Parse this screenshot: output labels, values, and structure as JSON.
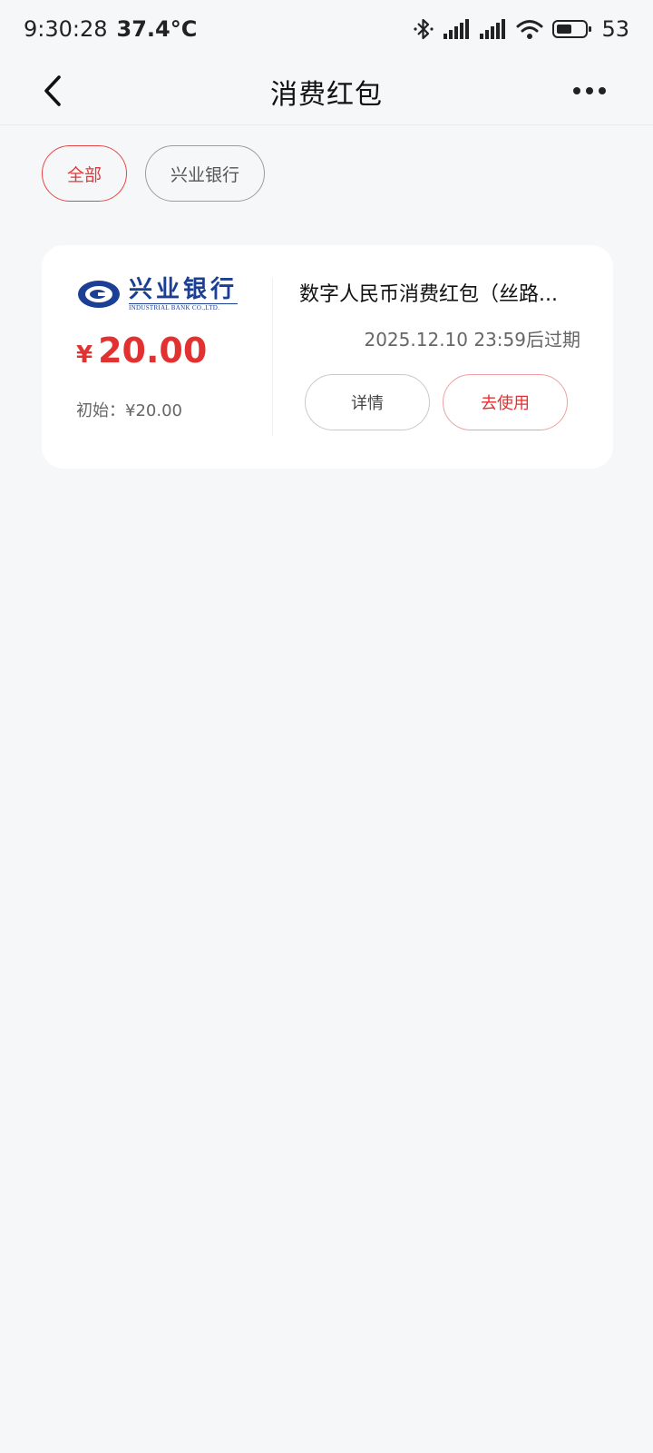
{
  "status_bar": {
    "time": "9:30:28",
    "temperature": "37.4°C",
    "battery": "53",
    "icons": [
      "bluetooth-icon",
      "signal-icon",
      "signal-icon",
      "wifi-icon",
      "battery-icon"
    ]
  },
  "header": {
    "title": "消费红包",
    "back_icon": "chevron-left-icon",
    "more_icon": "more-dots-icon"
  },
  "filters": [
    {
      "label": "全部",
      "active": true
    },
    {
      "label": "兴业银行",
      "active": false
    }
  ],
  "card": {
    "bank_logo": {
      "name_cn": "兴业银行",
      "name_en": "INDUSTRIAL BANK CO.,LTD."
    },
    "currency": "¥",
    "amount": "20.00",
    "initial": "初始：¥20.00",
    "title": "数字人民币消费红包（丝路...",
    "expire": "2025.12.10 23:59后过期",
    "detail_label": "详情",
    "use_label": "去使用"
  },
  "colors": {
    "accent": "#e23131",
    "background": "#f6f7f9",
    "bank_blue": "#1b3f94"
  }
}
